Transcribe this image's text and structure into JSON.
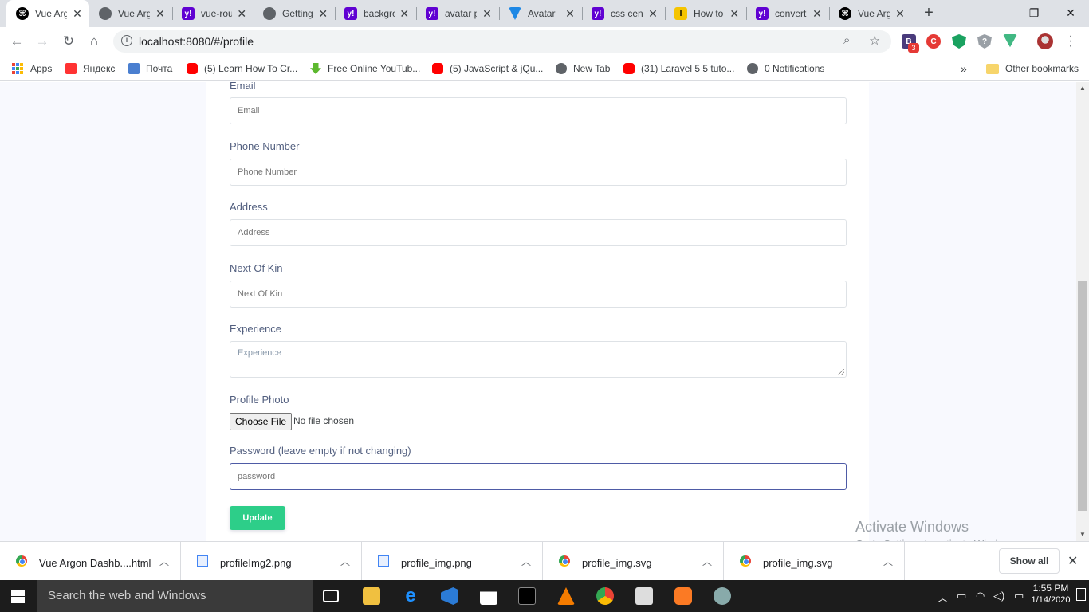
{
  "tabs": [
    {
      "title": "Vue Argon Dashboard",
      "icon": "vue-argon-icon",
      "active": true
    },
    {
      "title": "Vue Argon Dashboard",
      "icon": "globe-icon"
    },
    {
      "title": "vue-router",
      "icon": "yahoo-icon"
    },
    {
      "title": "Getting Started",
      "icon": "globe-icon"
    },
    {
      "title": "background",
      "icon": "yahoo-icon"
    },
    {
      "title": "avatar placeholder",
      "icon": "yahoo-icon"
    },
    {
      "title": "Avatar",
      "icon": "vuetify-icon"
    },
    {
      "title": "css center",
      "icon": "yahoo-icon"
    },
    {
      "title": "How to",
      "icon": "lemon-icon"
    },
    {
      "title": "convert",
      "icon": "yahoo-icon"
    },
    {
      "title": "Vue Argon Dashboard",
      "icon": "vue-argon-icon"
    }
  ],
  "tab_close_glyph": "✕",
  "new_tab_glyph": "+",
  "address": {
    "url": "localhost:8080/#/profile"
  },
  "extensions": {
    "badge": "3"
  },
  "bookmarks": {
    "apps": "Apps",
    "items": [
      {
        "label": "Яндекс",
        "icon": "yandex-icon"
      },
      {
        "label": "Почта",
        "icon": "mail-icon"
      },
      {
        "label": "(5) Learn How To Cr...",
        "icon": "youtube-icon"
      },
      {
        "label": "Free Online YouTub...",
        "icon": "download-icon"
      },
      {
        "label": "(5) JavaScript & jQu...",
        "icon": "youtube-icon"
      },
      {
        "label": "New Tab",
        "icon": "globe-icon"
      },
      {
        "label": "(31) Laravel 5 5 tuto...",
        "icon": "youtube-icon"
      },
      {
        "label": "0 Notifications",
        "icon": "globe-icon"
      }
    ],
    "overflow": "»",
    "other": "Other bookmarks"
  },
  "form": {
    "email": {
      "label": "Email",
      "placeholder": "Email"
    },
    "phone": {
      "label": "Phone Number",
      "placeholder": "Phone Number"
    },
    "address": {
      "label": "Address",
      "placeholder": "Address"
    },
    "kin": {
      "label": "Next Of Kin",
      "placeholder": "Next Of Kin"
    },
    "experience": {
      "label": "Experience",
      "placeholder": "Experience"
    },
    "photo": {
      "label": "Profile Photo",
      "button": "Choose File",
      "status": "No file chosen"
    },
    "password": {
      "label": "Password (leave empty if not changing)",
      "placeholder": "password"
    },
    "update": "Update"
  },
  "watermark": {
    "title": "Activate Windows",
    "subtitle": "Go to Settings to activate Windows."
  },
  "downloads": [
    {
      "name": "Vue Argon Dashb....html",
      "icon": "chrome-icon"
    },
    {
      "name": "profileImg2.png",
      "icon": "image-file-icon"
    },
    {
      "name": "profile_img.png",
      "icon": "image-file-icon"
    },
    {
      "name": "profile_img.svg",
      "icon": "chrome-icon"
    },
    {
      "name": "profile_img.svg",
      "icon": "chrome-icon"
    }
  ],
  "downloads_show_all": "Show all",
  "taskbar": {
    "search": "Search the web and Windows",
    "time": "1:55 PM",
    "date": "1/14/2020"
  },
  "colors": {
    "accent_success": "#2dce89",
    "focus_border": "#4e5ba6",
    "label_text": "#525f7f"
  }
}
